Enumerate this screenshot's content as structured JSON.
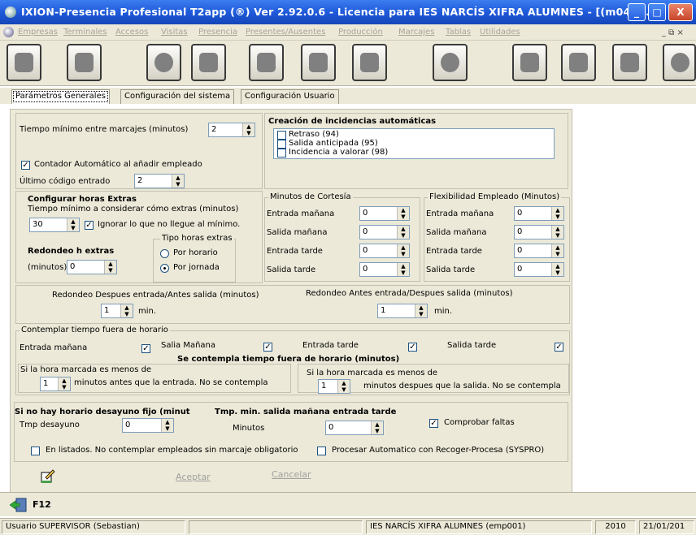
{
  "window": {
    "title": "IXION-Presencia Profesional T2app (®) Ver 2.92.0.6  -  Licencia para IES NARCÍS XIFRA ALUMNES - [(m040...",
    "minimize": "_",
    "maximize": "□",
    "close": "X"
  },
  "menu": {
    "items": [
      "Empresas",
      "Terminales",
      "Accesos",
      "Visitas",
      "Presencia",
      "Presentes/Ausentes",
      "Producción",
      "Marcajes",
      "Tablas",
      "Utilidades"
    ],
    "child_controls": "_ ⧉ ×"
  },
  "toolbar": {
    "icons": [
      "keys-icon",
      "users-icon",
      "door-icon",
      "book-icon",
      "settings-icon",
      "terminal-icon",
      "printer-icon",
      "help-icon",
      "map-icon",
      "person-icon",
      "calendar-icon",
      "clock-icon"
    ]
  },
  "tabs": [
    "Parámetros Generales",
    "Configuración del sistema",
    "Configuración Usuario"
  ],
  "general": {
    "min_time_label": "Tiempo mínimo entre marcajes (minutos)",
    "min_time_value": "2",
    "auto_counter_label": "Contador Automático al añadir empleado",
    "last_code_label": "Último código entrado",
    "last_code_value": "2"
  },
  "incidencias": {
    "title": "Creación de incidencias automáticas",
    "items": [
      "Retraso (94)",
      "Salida anticipada (95)",
      "Incidencia a valorar (98)"
    ]
  },
  "extras": {
    "title": "Configurar horas Extras",
    "min_label": "Tiempo mínimo a considerar cómo extras (minutos)",
    "min_value": "30",
    "ignore_label": "Ignorar lo que no llegue al mínimo.",
    "round_title": "Redondeo h extras",
    "round_label": "(minutos)",
    "round_value": "0",
    "type_title": "Tipo horas extras",
    "type_options": [
      "Por horario",
      "Por jornada"
    ]
  },
  "cortesia": {
    "title": "Minutos de Cortesía",
    "rows": [
      {
        "label": "Entrada mañana",
        "value": "0"
      },
      {
        "label": "Salida mañana",
        "value": "0"
      },
      {
        "label": "Entrada tarde",
        "value": "0"
      },
      {
        "label": "Salida tarde",
        "value": "0"
      }
    ]
  },
  "flexibilidad": {
    "title": "Flexibilidad Empleado (Minutos)",
    "rows": [
      {
        "label": "Entrada mañana",
        "value": "0"
      },
      {
        "label": "Salida mañana",
        "value": "0"
      },
      {
        "label": "Entrada tarde",
        "value": "0"
      },
      {
        "label": "Salida tarde",
        "value": "0"
      }
    ]
  },
  "redondeo": {
    "left_label": "Redondeo Despues entrada/Antes salida (minutos)",
    "left_value": "1",
    "right_label": "Redondeo Antes entrada/Despues salida (minutos)",
    "right_value": "1",
    "unit": "min."
  },
  "fuera": {
    "title": "Contemplar tiempo fuera de horario",
    "items": [
      "Entrada mañana",
      "Salia Mañana",
      "Entrada tarde",
      "Salida tarde"
    ],
    "subtitle": "Se contempla tiempo fuera de horario (minutos)",
    "before_title": "Si la hora marcada es menos de",
    "before_value": "1",
    "before_text": "minutos antes que la entrada. No se contempla",
    "after_title": "Si la hora marcada es menos de",
    "after_value": "1",
    "after_text": "minutos despues que la salida. No se contempla"
  },
  "desayuno": {
    "title": "Si no hay horario desayuno fijo (minut",
    "label": "Tmp desayuno",
    "value": "0"
  },
  "salida_tarde": {
    "title": "Tmp. min. salida mañana entrada tarde",
    "label": "Minutos",
    "value": "0"
  },
  "faltas_label": "Comprobar faltas",
  "listados_label": "En listados. No contemplar empleados sin marcaje obligatorio",
  "syspro_label": "Procesar Automatico con Recoger-Procesa (SYSPRO)",
  "actions": {
    "accept": "Aceptar",
    "cancel": "Cancelar"
  },
  "f12_label": "F12",
  "status": {
    "user": "Usuario SUPERVISOR (Sebastian)",
    "company": "IES NARCÍS XIFRA ALUMNES  (emp001)",
    "year": "2010",
    "date": "21/01/201"
  }
}
